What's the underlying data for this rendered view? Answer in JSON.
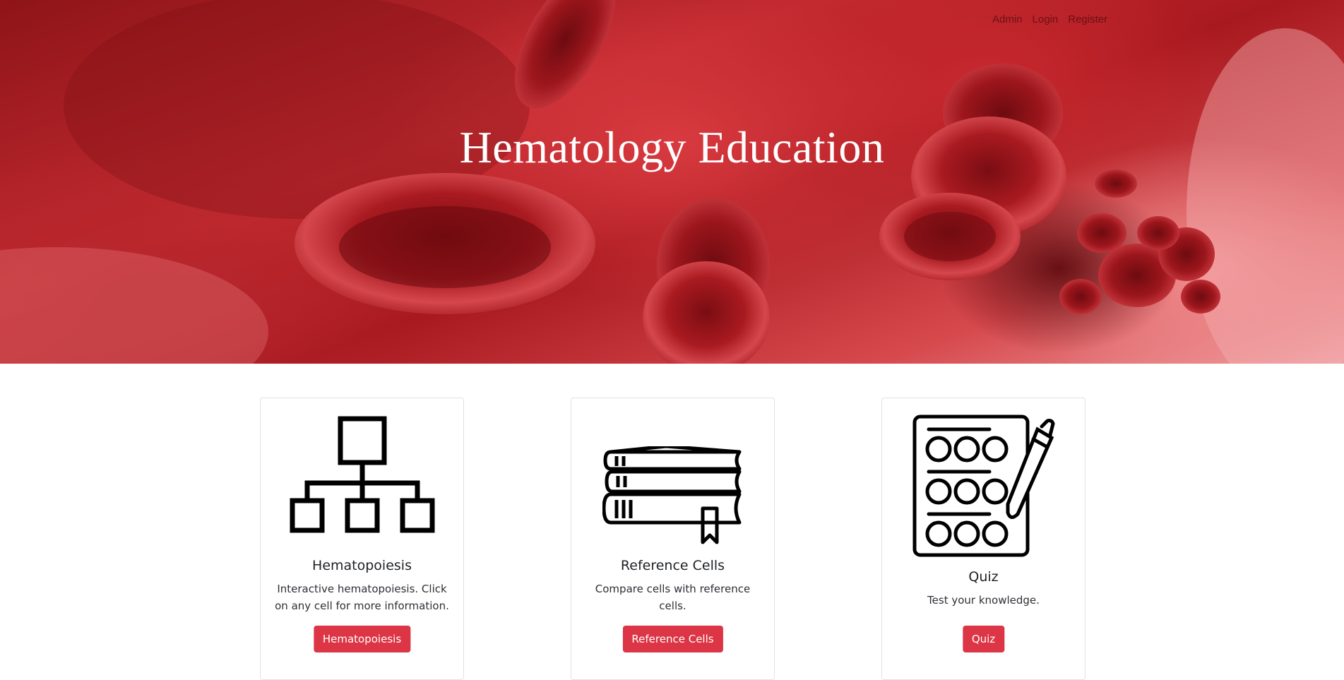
{
  "nav": {
    "links": [
      "Admin",
      "Login",
      "Register"
    ]
  },
  "hero": {
    "title": "Hematology Education"
  },
  "cards": [
    {
      "icon": "hierarchy-chart-icon",
      "title": "Hematopoiesis",
      "text": "Interactive hematopoiesis. Click on any cell for more information.",
      "button": "Hematopoiesis"
    },
    {
      "icon": "books-icon",
      "title": "Reference Cells",
      "text": "Compare cells with reference cells.",
      "button": "Reference Cells"
    },
    {
      "icon": "quiz-sheet-icon",
      "title": "Quiz",
      "text": "Test your knowledge.",
      "button": "Quiz"
    }
  ],
  "colors": {
    "button": "#dc3545",
    "hero_red": "#c22a30",
    "hero_text": "#ffffff"
  }
}
